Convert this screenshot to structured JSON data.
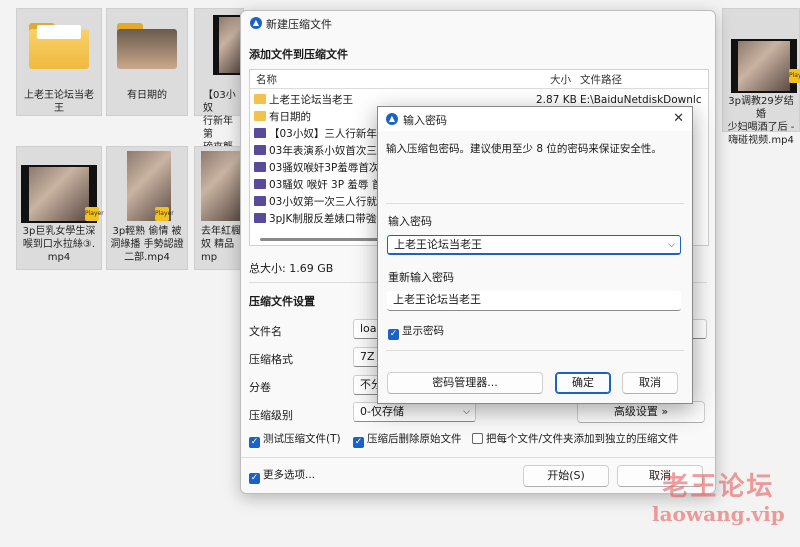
{
  "explorer": {
    "items": [
      {
        "caption": "上老王论坛当老\n王"
      },
      {
        "caption": "有日期的"
      },
      {
        "caption": "【03小奴\n行新年第\n磅來襲"
      },
      {
        "caption": "3p调教29岁结婚\n少妇喝酒了后 -\n嗨碰视频.mp4"
      },
      {
        "caption": "3p巨乳女學生深\n喉到口水拉絲③.\nmp4"
      },
      {
        "caption": "3p輕熟 偷情 被\n洞綠播 手勢認證\n二部.mp4"
      },
      {
        "caption": "去年紅楓\n奴 精品\nmp"
      }
    ],
    "player_badge": "Player"
  },
  "main": {
    "title": "新建压缩文件",
    "add_section": "添加文件到压缩文件",
    "columns": {
      "name": "名称",
      "size": "大小",
      "path": "文件路径"
    },
    "files": [
      {
        "name": "上老王论坛当老王",
        "size": "2.87 KB",
        "path": "E:\\BaiduNetdiskDownlc",
        "kind": "folder"
      },
      {
        "name": "有日期的",
        "size": "",
        "path": "",
        "kind": "folder"
      },
      {
        "name": "【03小奴】三人行新年第",
        "size": "",
        "path": "",
        "kind": "video"
      },
      {
        "name": "03年表演系小奴首次三人",
        "size": "",
        "path": "",
        "kind": "video"
      },
      {
        "name": "03骚奴喉奸3P羞辱首次三",
        "size": "",
        "path": "",
        "kind": "video"
      },
      {
        "name": "03騷奴 喉奸 3P 羞辱 首次",
        "size": "",
        "path": "",
        "kind": "video"
      },
      {
        "name": "03小奴第一次三人行就特",
        "size": "",
        "path": "",
        "kind": "video"
      },
      {
        "name": "3pJK制服反差婊口带強制",
        "size": "",
        "path": "",
        "kind": "video"
      }
    ],
    "total_size": "总大小: 1.69 GB",
    "settings_section": "压缩文件设置",
    "filename_label": "文件名",
    "filename_value": "loa",
    "format_label": "压缩格式",
    "format_value": "7Z",
    "split_label": "分卷",
    "split_value": "不分",
    "level_label": "压缩级别",
    "level_value": "0-仅存储",
    "advanced_button": "高级设置 »",
    "test_checkbox": "测试压缩文件(T)",
    "delete_checkbox": "压缩后删除原始文件",
    "separate_checkbox": "把每个文件/文件夹添加到独立的压缩文件",
    "more_options": "更多选项...",
    "start_button": "开始(S)",
    "cancel_button": "取消"
  },
  "password_dialog": {
    "title": "输入密码",
    "hint": "输入压缩包密码。建议使用至少 8 位的密码来保证安全性。",
    "password_label": "输入密码",
    "password_value": "上老王论坛当老王",
    "confirm_label": "重新输入密码",
    "confirm_value": "上老王论坛当老王",
    "show_password": "显示密码",
    "manager_button": "密码管理器...",
    "ok_button": "确定",
    "cancel_button": "取消"
  },
  "watermark": {
    "line1": "老王论坛",
    "line2": "laowang.vip"
  },
  "colors": {
    "accent": "#1a62c7",
    "folder": "#f2c14e",
    "watermark": "#e44e4e"
  }
}
